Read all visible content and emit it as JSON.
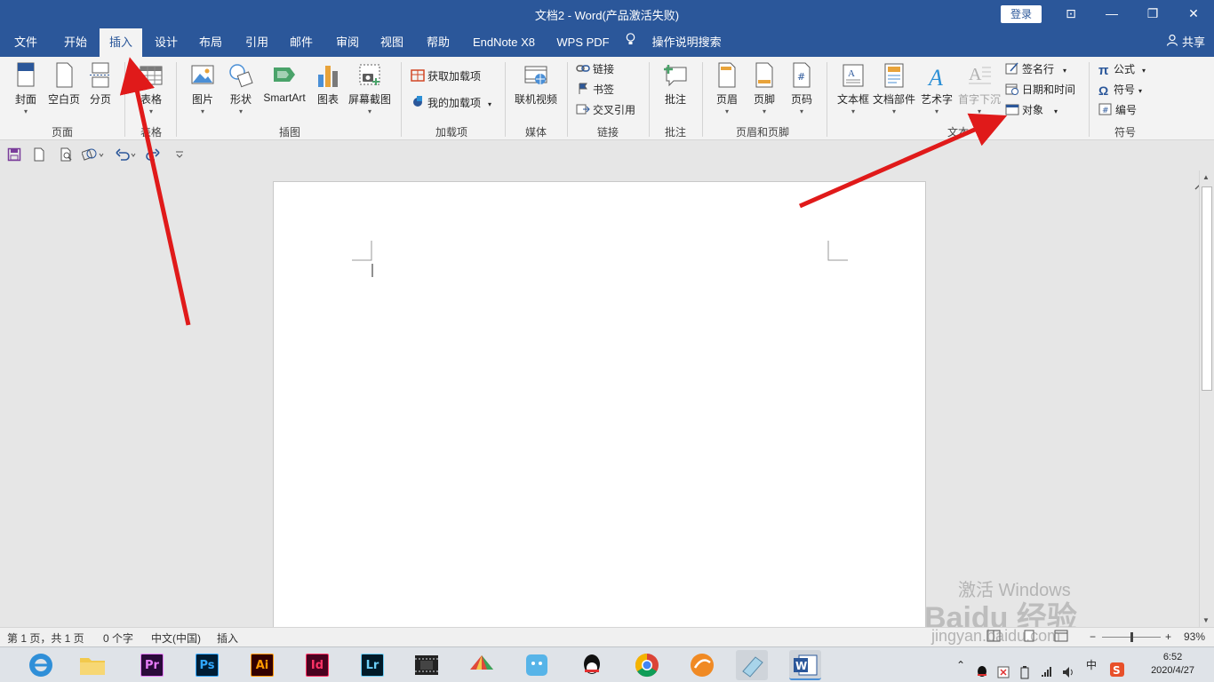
{
  "window": {
    "title": "文档2  -  Word(产品激活失败)",
    "login_label": "登录",
    "controls": {
      "ribbon_opts": "⊡",
      "minimize": "—",
      "restore": "❐",
      "close": "✕"
    }
  },
  "tabs": [
    "文件",
    "开始",
    "插入",
    "设计",
    "布局",
    "引用",
    "邮件",
    "审阅",
    "视图",
    "帮助",
    "EndNote X8",
    "WPS PDF"
  ],
  "active_tab": "插入",
  "tell_me": "操作说明搜索",
  "share_label": "共享",
  "ribbon": {
    "pages": {
      "label": "页面",
      "cover": "封面",
      "blank": "空白页",
      "break": "分页"
    },
    "tables": {
      "label": "表格",
      "table": "表格"
    },
    "illustrations": {
      "label": "插图",
      "pictures": "图片",
      "shapes": "形状",
      "smartart": "SmartArt",
      "chart": "图表",
      "screenshot": "屏幕截图"
    },
    "addins": {
      "label": "加载项",
      "get": "获取加载项",
      "my": "我的加载项"
    },
    "media": {
      "label": "媒体",
      "online_video": "联机视频"
    },
    "links": {
      "label": "链接",
      "link": "链接",
      "bookmark": "书签",
      "cross_ref": "交叉引用"
    },
    "comments": {
      "label": "批注",
      "comment": "批注"
    },
    "header_footer": {
      "label": "页眉和页脚",
      "header": "页眉",
      "footer": "页脚",
      "page_number": "页码"
    },
    "text": {
      "label": "文本",
      "textbox": "文本框",
      "quick_parts": "文档部件",
      "wordart": "艺术字",
      "dropcap": "首字下沉",
      "signature": "签名行",
      "datetime": "日期和时间",
      "object": "对象"
    },
    "symbols": {
      "label": "符号",
      "equation": "公式",
      "symbol": "符号",
      "number": "编号"
    }
  },
  "status": {
    "page": "第 1 页，共 1 页",
    "words": "0 个字",
    "language": "中文(中国)",
    "mode": "插入",
    "zoom": "93%",
    "minus": "−",
    "plus": "+"
  },
  "taskbar": {
    "apps": [
      {
        "name": "Pr",
        "color": "#2a0a3a",
        "fg": "#e77cf8"
      },
      {
        "name": "Ps",
        "color": "#001d34",
        "fg": "#31a8ff"
      },
      {
        "name": "Ai",
        "color": "#330000",
        "fg": "#ff9a00"
      },
      {
        "name": "Id",
        "color": "#49021f",
        "fg": "#ff3366"
      },
      {
        "name": "Lr",
        "color": "#001a28",
        "fg": "#6ccff6"
      }
    ],
    "ime": "中",
    "time": "6:52",
    "date": "2020/4/27"
  },
  "watermark": {
    "line1": "激活 Windows",
    "line2": "Baidu 经验",
    "line3": "jingyan.baidu.com"
  },
  "colors": {
    "word_blue": "#2b579a",
    "arrow_red": "#e01a1a"
  }
}
